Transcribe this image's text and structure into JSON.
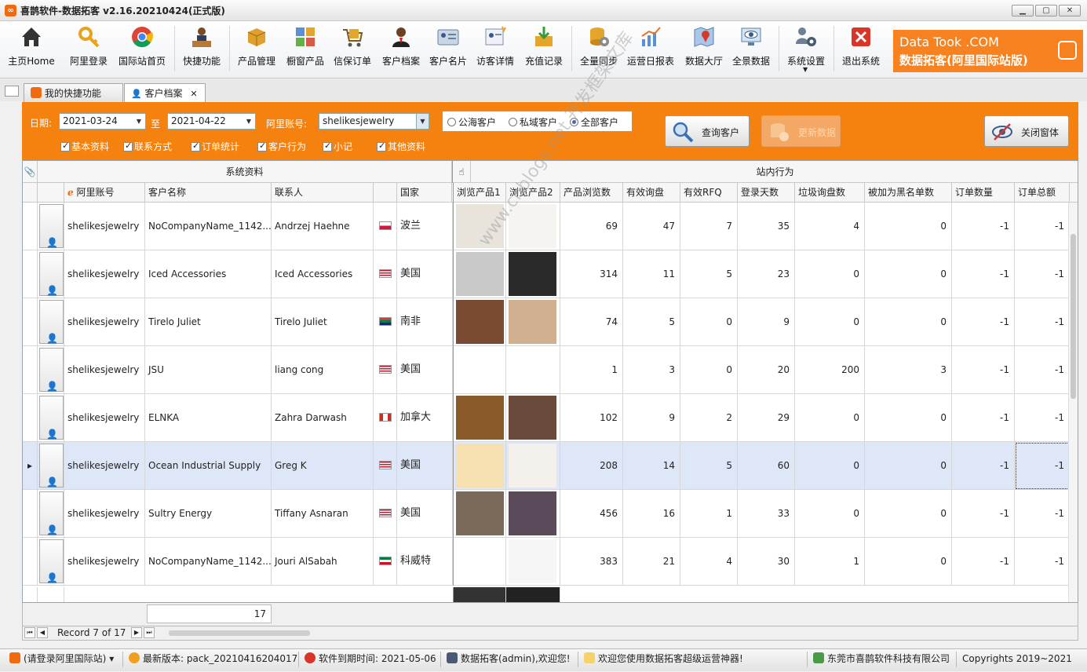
{
  "window": {
    "title": "喜鹊软件-数据拓客 v2.16.20210424(正式版)"
  },
  "toolbar": [
    {
      "label": "主页Home",
      "icon": "home-icon"
    },
    {
      "label": "阿里登录",
      "icon": "key-icon"
    },
    {
      "label": "国际站首页",
      "icon": "chrome-icon"
    },
    {
      "label": "快捷功能",
      "icon": "desk-person-icon"
    },
    {
      "label": "产品管理",
      "icon": "box-icon"
    },
    {
      "label": "橱窗产品",
      "icon": "window-grid-icon"
    },
    {
      "label": "信保订单",
      "icon": "cart-icon"
    },
    {
      "label": "客户档案",
      "icon": "customer-icon"
    },
    {
      "label": "客户名片",
      "icon": "card-icon"
    },
    {
      "label": "访客详情",
      "icon": "visitor-icon"
    },
    {
      "label": "充值记录",
      "icon": "inbox-icon"
    },
    {
      "label": "全量同步",
      "icon": "db-gear-icon"
    },
    {
      "label": "运营日报表",
      "icon": "chart-icon"
    },
    {
      "label": "数据大厅",
      "icon": "map-icon"
    },
    {
      "label": "全景数据",
      "icon": "screen-eye-icon"
    },
    {
      "label": "系统设置",
      "icon": "users-gear-icon"
    },
    {
      "label": "退出系统",
      "icon": "close-red-icon"
    }
  ],
  "banner": {
    "line1": "Data Took .COM",
    "line2": "数据拓客(阿里国际站版)"
  },
  "tabs": [
    {
      "label": "我的快捷功能"
    },
    {
      "label": "客户档案"
    }
  ],
  "filter": {
    "date_label": "日期:",
    "date_from": "2021-03-24",
    "to_label": "至",
    "date_to": "2021-04-22",
    "account_label": "阿里账号:",
    "account": "shelikesjewelry",
    "radios": [
      {
        "label": "公海客户",
        "checked": false
      },
      {
        "label": "私域客户",
        "checked": false
      },
      {
        "label": "全部客户",
        "checked": true
      }
    ],
    "checks": [
      "基本资料",
      "联系方式",
      "订单统计",
      "客户行为",
      "小记",
      "其他资料"
    ],
    "query_btn": "查询客户",
    "update_btn": "更新数据",
    "close_btn": "关闭窗体"
  },
  "grid": {
    "band_left": "系统资料",
    "band_right": "站内行为",
    "headers": [
      "阿里账号",
      "客户名称",
      "联系人",
      "国家",
      "浏览产品1",
      "浏览产品2",
      "产品浏览数",
      "有效询盘",
      "有效RFQ",
      "登录天数",
      "垃圾询盘数",
      "被加为黑名单数",
      "订单数量",
      "订单总额"
    ],
    "rows": [
      {
        "account": "shelikesjewelry",
        "name": "NoCompanyName_1142...",
        "contact": "Andrzej Haehne",
        "flag": "pl",
        "country": "波兰",
        "views": "69",
        "inquiries": "47",
        "rfq": "7",
        "days": "35",
        "spam": "4",
        "blacklist": "0",
        "orders": "-1",
        "total": "-1"
      },
      {
        "account": "shelikesjewelry",
        "name": "Iced Accessories",
        "contact": "Iced Accessories",
        "flag": "us",
        "country": "美国",
        "views": "314",
        "inquiries": "11",
        "rfq": "5",
        "days": "23",
        "spam": "0",
        "blacklist": "0",
        "orders": "-1",
        "total": "-1"
      },
      {
        "account": "shelikesjewelry",
        "name": "Tirelo Juliet",
        "contact": "Tirelo Juliet",
        "flag": "za",
        "country": "南非",
        "views": "74",
        "inquiries": "5",
        "rfq": "0",
        "days": "9",
        "spam": "0",
        "blacklist": "0",
        "orders": "-1",
        "total": "-1"
      },
      {
        "account": "shelikesjewelry",
        "name": "JSU",
        "contact": "liang cong",
        "flag": "us",
        "country": "美国",
        "views": "1",
        "inquiries": "3",
        "rfq": "0",
        "days": "20",
        "spam": "200",
        "blacklist": "3",
        "orders": "-1",
        "total": "-1"
      },
      {
        "account": "shelikesjewelry",
        "name": "ELNKA",
        "contact": "Zahra Darwash",
        "flag": "ca",
        "country": "加拿大",
        "views": "102",
        "inquiries": "9",
        "rfq": "2",
        "days": "29",
        "spam": "0",
        "blacklist": "0",
        "orders": "-1",
        "total": "-1"
      },
      {
        "account": "shelikesjewelry",
        "name": "Ocean Industrial Supply",
        "contact": "Greg K",
        "flag": "us",
        "country": "美国",
        "views": "208",
        "inquiries": "14",
        "rfq": "5",
        "days": "60",
        "spam": "0",
        "blacklist": "0",
        "orders": "-1",
        "total": "-1"
      },
      {
        "account": "shelikesjewelry",
        "name": "Sultry Energy",
        "contact": "Tiffany Asnaran",
        "flag": "us",
        "country": "美国",
        "views": "456",
        "inquiries": "16",
        "rfq": "1",
        "days": "33",
        "spam": "0",
        "blacklist": "0",
        "orders": "-1",
        "total": "-1"
      },
      {
        "account": "shelikesjewelry",
        "name": "NoCompanyName_1142...",
        "contact": "Jouri AlSabah",
        "flag": "kw",
        "country": "科威特",
        "views": "383",
        "inquiries": "21",
        "rfq": "4",
        "days": "30",
        "spam": "1",
        "blacklist": "0",
        "orders": "-1",
        "total": "-1"
      }
    ],
    "count_total": "17",
    "record_text": "Record 7 of 17"
  },
  "watermark": "www.cnblogs.net 开发框架文库",
  "status": {
    "login": "(请登录阿里国际站)",
    "version": "最新版本: pack_20210416204017",
    "expiry": "软件到期时间: 2021-05-06",
    "user": "数据拓客(admin),欢迎您!",
    "welcome": "欢迎您使用数据拓客超级运营神器!",
    "company": "东莞市喜鹊软件科技有限公司",
    "copyright": "Copyrights 2019~2021"
  }
}
